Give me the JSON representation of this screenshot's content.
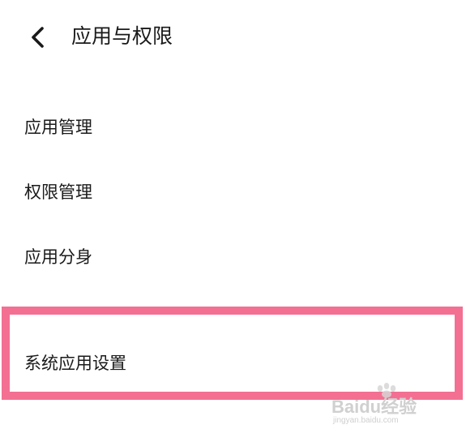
{
  "header": {
    "title": "应用与权限",
    "back_icon": "chevron-left-icon"
  },
  "menu": {
    "items": [
      {
        "label": "应用管理"
      },
      {
        "label": "权限管理"
      },
      {
        "label": "应用分身"
      },
      {
        "label": "系统应用设置",
        "highlighted": true
      }
    ]
  },
  "highlight_color": "#f37092",
  "watermark": {
    "brand": "Baidu经验",
    "url": "jingyan.baidu.com"
  }
}
